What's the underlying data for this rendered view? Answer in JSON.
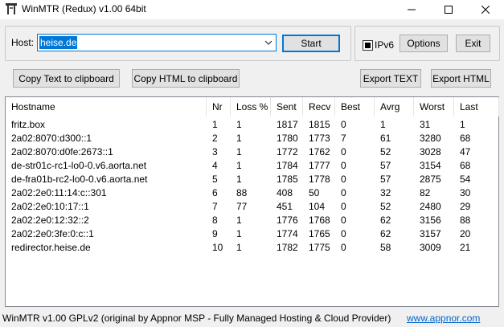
{
  "window": {
    "title": "WinMTR (Redux) v1.00 64bit"
  },
  "host": {
    "label": "Host:",
    "value": "heise.de"
  },
  "buttons": {
    "start": "Start",
    "options": "Options",
    "exit": "Exit",
    "copy_text": "Copy Text to clipboard",
    "copy_html": "Copy HTML to clipboard",
    "export_text": "Export TEXT",
    "export_html": "Export HTML"
  },
  "ipv6": {
    "label": "IPv6",
    "checked": true
  },
  "table": {
    "columns": [
      "Hostname",
      "Nr",
      "Loss %",
      "Sent",
      "Recv",
      "Best",
      "Avrg",
      "Worst",
      "Last"
    ],
    "rows": [
      [
        "fritz.box",
        "1",
        "1",
        "1817",
        "1815",
        "0",
        "1",
        "31",
        "1"
      ],
      [
        "2a02:8070:d300::1",
        "2",
        "1",
        "1780",
        "1773",
        "7",
        "61",
        "3280",
        "68"
      ],
      [
        "2a02:8070:d0fe:2673::1",
        "3",
        "1",
        "1772",
        "1762",
        "0",
        "52",
        "3028",
        "47"
      ],
      [
        "de-str01c-rc1-lo0-0.v6.aorta.net",
        "4",
        "1",
        "1784",
        "1777",
        "0",
        "57",
        "3154",
        "68"
      ],
      [
        "de-fra01b-rc2-lo0-0.v6.aorta.net",
        "5",
        "1",
        "1785",
        "1778",
        "0",
        "57",
        "2875",
        "54"
      ],
      [
        "2a02:2e0:11:14:c::301",
        "6",
        "88",
        "408",
        "50",
        "0",
        "32",
        "82",
        "30"
      ],
      [
        "2a02:2e0:10:17::1",
        "7",
        "77",
        "451",
        "104",
        "0",
        "52",
        "2480",
        "29"
      ],
      [
        "2a02:2e0:12:32::2",
        "8",
        "1",
        "1776",
        "1768",
        "0",
        "62",
        "3156",
        "88"
      ],
      [
        "2a02:2e0:3fe:0:c::1",
        "9",
        "1",
        "1774",
        "1765",
        "0",
        "62",
        "3157",
        "20"
      ],
      [
        "redirector.heise.de",
        "10",
        "1",
        "1782",
        "1775",
        "0",
        "58",
        "3009",
        "21"
      ]
    ]
  },
  "status": {
    "text": "WinMTR v1.00 GPLv2 (original by Appnor MSP - Fully Managed Hosting & Cloud Provider)",
    "link": "www.appnor.com"
  },
  "colors": {
    "accent": "#0078d7",
    "link": "#0066cc"
  },
  "icons": [
    "winmtr-app-icon",
    "minimize-icon",
    "maximize-icon",
    "close-icon",
    "dropdown-arrow-icon"
  ]
}
